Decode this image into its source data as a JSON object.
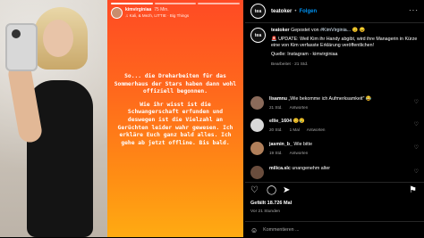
{
  "story": {
    "username": "kimvirginiaa",
    "time": "75 Min.",
    "music": "Kali, & Mezh, LITTIE · Big Things",
    "paragraphs": [
      "So... die Dreharbeiten für das Sommerhaus der Stars haben dann wohl offiziell begonnen.",
      "Wie ihr wisst ist die Schwangerschaft erfunden und deswegen ist die Vielzahl an Gerüchten leider wahr gewesen. Ich erkläre Euch ganz bald alles. Ich gehe ab jetzt offline. Bis bald."
    ]
  },
  "post": {
    "username": "teatoker",
    "avatar_text": "tea",
    "follow_label": "Folgen",
    "caption": {
      "username": "teatoker",
      "line1_prefix": "Gepostet von",
      "line1_link": "#KimVirginia...",
      "line1_suffix": "😐 😖",
      "line2": "🚨 UPDATE: Weil Kim ihr Handy abgibt, wird ihre Managerin in Kürze eine von Kim verfasste Erklärung veröffentlichen!",
      "line3": "Quelle: Instagram - kimvirginiaa",
      "meta": "Bearbeitet · 21 Std."
    },
    "comments": [
      {
        "user": "lisamnu",
        "text": "„Wie bekomme ich Aufmerksamkeit\" 😂",
        "time": "21 Std.",
        "likes": "",
        "reply": "Antworten",
        "color": "#8a6a5a"
      },
      {
        "user": "ellie_1604",
        "text": "😊😢",
        "time": "20 Std.",
        "likes": "1 Mal",
        "reply": "Antworten",
        "color": "#d8d8d8"
      },
      {
        "user": "jasmin_b_",
        "text": "Wie bitte",
        "time": "19 Std.",
        "likes": "",
        "reply": "Antworten",
        "color": "#b07f5a"
      },
      {
        "user": "milica.slc",
        "text": "unangenehm alter",
        "time": "",
        "likes": "",
        "reply": "",
        "color": "#6a4d3d"
      }
    ],
    "likes": "Gefällt 18.726 Mal",
    "posted": "Vor 21 Stunden",
    "comment_placeholder": "Kommentieren ..."
  },
  "icons": {
    "heart": "♡",
    "comment": "◯",
    "share": "➤",
    "bookmark": "⚑",
    "emoji": "☺",
    "more": "···"
  }
}
